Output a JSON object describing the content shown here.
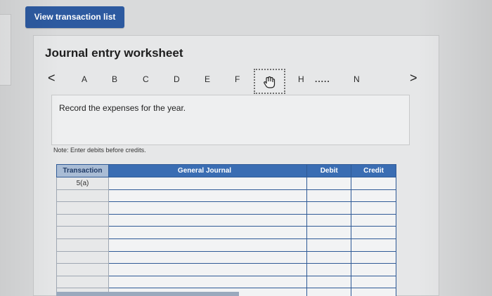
{
  "top_button": {
    "label": "View transaction list"
  },
  "worksheet": {
    "title": "Journal entry worksheet",
    "nav_prev": "<",
    "nav_next": ">",
    "tabs": [
      "A",
      "B",
      "C",
      "D",
      "E",
      "F",
      "",
      "H",
      ".....",
      "N"
    ],
    "instruction": "Record the expenses for the year.",
    "note": "Note: Enter debits before credits."
  },
  "table": {
    "headers": [
      "Transaction",
      "General Journal",
      "Debit",
      "Credit"
    ],
    "rows": [
      [
        "5(a)",
        "",
        "",
        ""
      ],
      [
        "",
        "",
        "",
        ""
      ],
      [
        "",
        "",
        "",
        ""
      ],
      [
        "",
        "",
        "",
        ""
      ],
      [
        "",
        "",
        "",
        ""
      ],
      [
        "",
        "",
        "",
        ""
      ],
      [
        "",
        "",
        "",
        ""
      ],
      [
        "",
        "",
        "",
        ""
      ],
      [
        "",
        "",
        "",
        ""
      ],
      [
        "",
        "",
        "",
        ""
      ]
    ]
  },
  "colors": {
    "header_blue": "#3a6db3",
    "button_blue": "#2d5aa0"
  }
}
